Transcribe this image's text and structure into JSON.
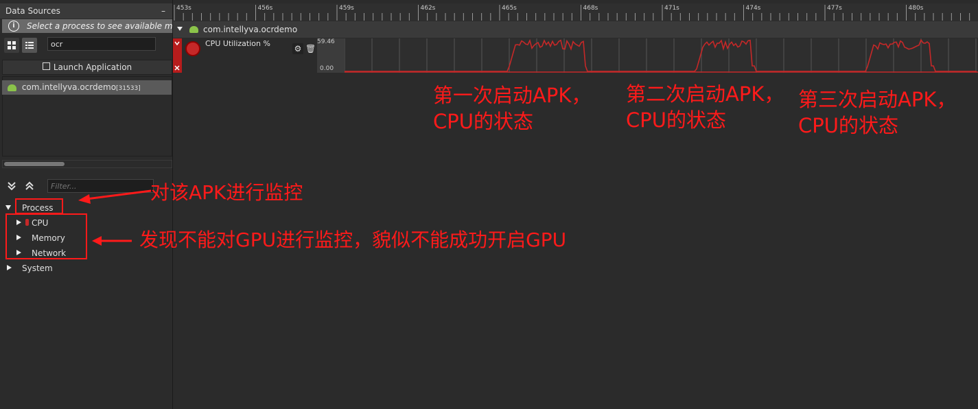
{
  "data_sources": {
    "title": "Data Sources",
    "minimize": "–",
    "info_text": "Select a process to see available met",
    "search_value": "ocr",
    "launch_label": "Launch Application",
    "process_name": "com.intellyva.ocrdemo",
    "process_pid": "[31533]",
    "filter_placeholder": "Filter..."
  },
  "tree": {
    "process": "Process",
    "cpu": "CPU",
    "memory": "Memory",
    "network": "Network",
    "system": "System"
  },
  "timeline": {
    "ticks": [
      "453s",
      "456s",
      "459s",
      "462s",
      "465s",
      "468s",
      "471s",
      "474s",
      "477s",
      "480s"
    ],
    "app_name": "com.intellyva.ocrdemo",
    "track_label": "CPU Utilization %",
    "y_max": "59.46",
    "y_min": "0.00"
  },
  "annotations": {
    "first": [
      "第一次启动APK，",
      "CPU的状态"
    ],
    "second": [
      "第二次启动APK，",
      "CPU的状态"
    ],
    "third": [
      "第三次启动APK，",
      "CPU的状态"
    ],
    "monitor": "对该APK进行监控",
    "gpu": "发现不能对GPU进行监控，貌似不能成功开启GPU"
  },
  "colors": {
    "annotation": "#ff1a1a",
    "cpu_line": "#c62828",
    "selected_item": "#5a5a5a",
    "android": "#8bc34a"
  }
}
